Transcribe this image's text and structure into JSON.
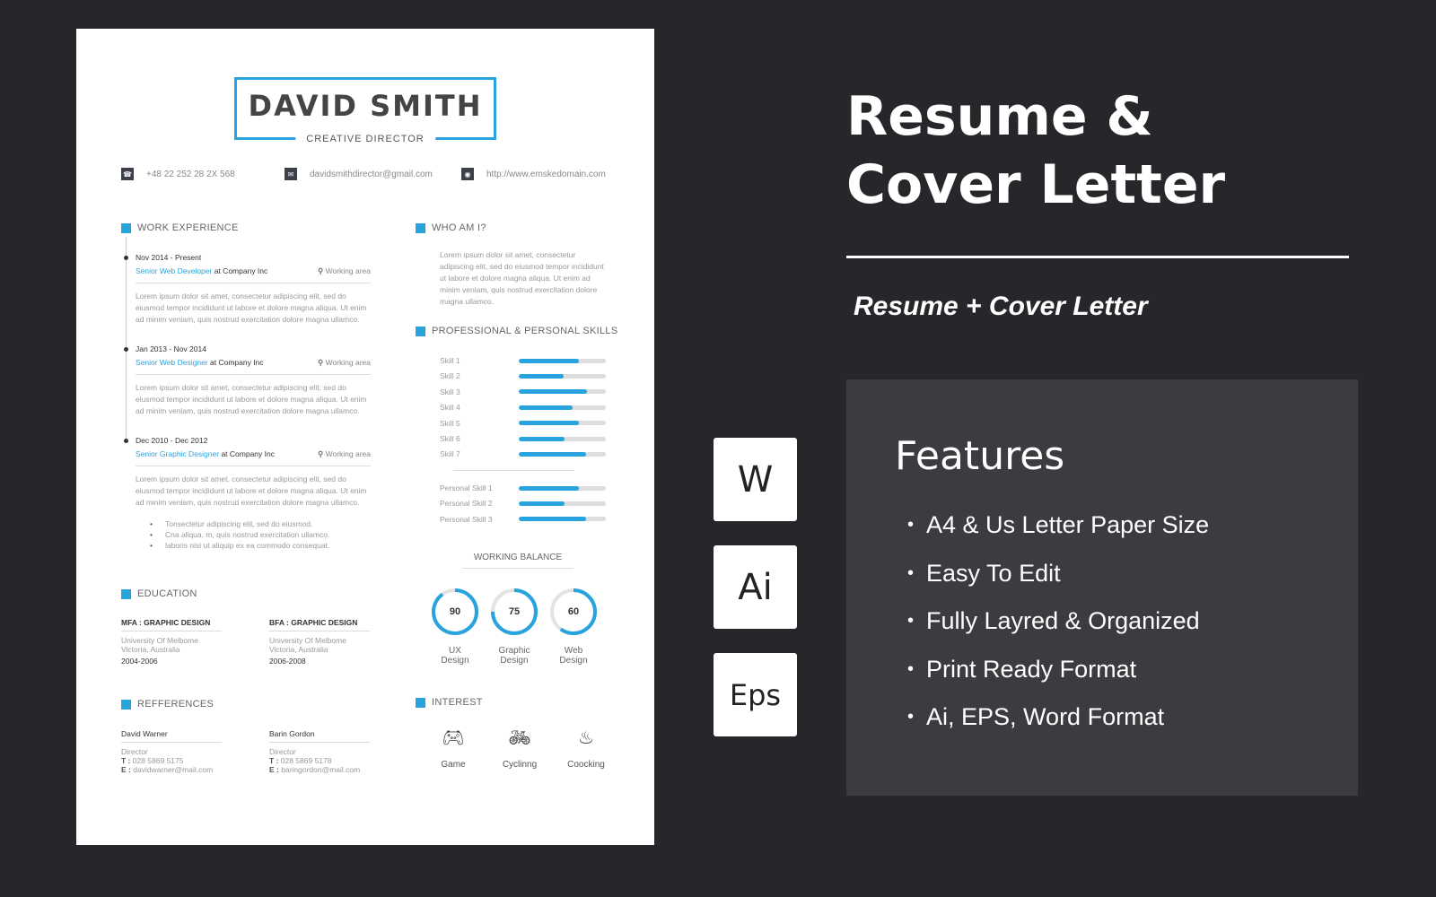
{
  "resume": {
    "name": "DAVID SMITH",
    "role": "CREATIVE DIRECTOR",
    "contacts": [
      {
        "icon": "phone-icon",
        "text": "+48 22 252 28 2X 568"
      },
      {
        "icon": "mail-icon",
        "text": "davidsmithdirector@gmail.com"
      },
      {
        "icon": "globe-icon",
        "text": "http://www.emskedomain.com"
      }
    ],
    "sections": {
      "work": "WORK EXPERIENCE",
      "who": "WHO AM I?",
      "skills": "PROFESSIONAL & PERSONAL SKILLS",
      "balance": "WORKING BALANCE",
      "education": "EDUCATION",
      "references": "REFFERENCES",
      "interest": "INTEREST"
    },
    "jobs": [
      {
        "date": "Nov 2014 - Present",
        "title": "Senior Web Developer",
        "company": " at Company Inc",
        "area": "Working area",
        "desc": "Lorem ipsum dolor sit amet, consectetur adipiscing elit, sed do eiusmod tempor incididunt ut labore et dolore magna aliqua. Ut enim ad minim veniam, quis nostrud exercitation dolore magna ullamco."
      },
      {
        "date": "Jan 2013 - Nov 2014",
        "title": "Senior Web Designer",
        "company": " at Company Inc",
        "area": "Working area",
        "desc": "Lorem ipsum dolor sit amet, consectetur adipiscing elit, sed do eiusmod tempor incididunt ut labore et dolore magna aliqua. Ut enim ad minim veniam, quis nostrud exercitation dolore magna ullamco."
      },
      {
        "date": "Dec 2010 - Dec 2012",
        "title": "Senior Graphic Designer",
        "company": " at Company Inc",
        "area": "Working area",
        "desc": "Lorem ipsum dolor sit amet, consectetur adipiscing elit, sed do eiusmod tempor incididunt ut labore et dolore magna aliqua. Ut enim ad minim veniam, quis nostrud exercitation dolore magna ullamco."
      }
    ],
    "bullets": [
      "Tonsectetur adipiscing elit, sed do eiusmod.",
      "Cna aliqua. m, quis nostrud exercitation ullamco.",
      "laboris nisi ut aliquip ex ea commodo consequat."
    ],
    "who_text": "Lorem ipsum dolor sit amet, consectetur adipiscing elit, sed do eiusmod tempor incididunt ut labore et dolore magna aliqua. Ut enim ad minim veniam, quis nostrud exercitation dolore magna ullamco.",
    "skills": [
      {
        "label": "Skill 1",
        "pct": 69
      },
      {
        "label": "Skill 2",
        "pct": 52
      },
      {
        "label": "Skill 3",
        "pct": 78
      },
      {
        "label": "Skill 4",
        "pct": 62
      },
      {
        "label": "Skill 5",
        "pct": 69
      },
      {
        "label": "Skill 6",
        "pct": 53
      },
      {
        "label": "Skill 7",
        "pct": 77
      }
    ],
    "personal_skills": [
      {
        "label": "Personal Skill 1",
        "pct": 69
      },
      {
        "label": "Personal Skill 2",
        "pct": 53
      },
      {
        "label": "Personal Skill 3",
        "pct": 77
      }
    ],
    "balance": [
      {
        "value": "90",
        "l1": "UX",
        "l2": "Design"
      },
      {
        "value": "75",
        "l1": "Graphic",
        "l2": "Design"
      },
      {
        "value": "60",
        "l1": "Web",
        "l2": "Design"
      }
    ],
    "education": [
      {
        "degree": "MFA  : GRAPHIC DESIGN",
        "school": "University Of Melbome",
        "place": "Victoria, Australia",
        "years": "2004-2006"
      },
      {
        "degree": "BFA  : GRAPHIC DESIGN",
        "school": "University Of Melbome",
        "place": "Victoria, Australia",
        "years": "2006-2008"
      }
    ],
    "references": [
      {
        "name": "David Warner",
        "role": "Director",
        "t_label": "T :",
        "phone": " 028 5869 5175",
        "e_label": "E :",
        "email": " davidwarner@mail.com"
      },
      {
        "name": "Barin Gordon",
        "role": "Director",
        "t_label": "T :",
        "phone": " 028 5869 5178",
        "e_label": "E :",
        "email": " baringordon@mail.com"
      }
    ],
    "interests": [
      {
        "icon": "gamepad-icon",
        "label": "Game"
      },
      {
        "icon": "bicycle-icon",
        "label": "Cyclinng"
      },
      {
        "icon": "chef-hat-icon",
        "label": "Coocking"
      }
    ],
    "accent": "#29a3dd"
  },
  "promo": {
    "title_line1": "Resume &",
    "title_line2": "Cover  Letter",
    "subtitle": "Resume + Cover Letter",
    "formats": [
      "W",
      "Ai",
      "Eps"
    ],
    "features_title": "Features",
    "features": [
      "A4 & Us Letter Paper Size",
      "Easy To Edit",
      "Fully Layred & Organized",
      "Print Ready Format",
      "Ai, EPS, Word Format"
    ]
  }
}
